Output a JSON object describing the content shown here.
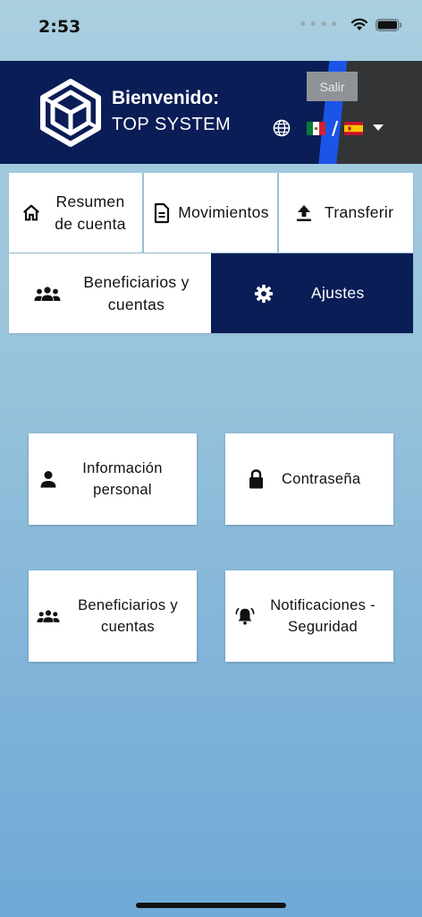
{
  "status": {
    "time": "2:53"
  },
  "header": {
    "welcome": "Bienvenido:",
    "company": "TOP SYSTEM",
    "logout_label": "Salir",
    "lang_separator": "/"
  },
  "nav": {
    "items": [
      {
        "label": "Resumen de cuenta",
        "icon": "home-icon"
      },
      {
        "label": "Movimientos",
        "icon": "document-icon"
      },
      {
        "label": "Transferir",
        "icon": "upload-icon"
      },
      {
        "label": "Beneficiarios y cuentas",
        "icon": "people-icon"
      },
      {
        "label": "Ajustes",
        "icon": "gear-icon",
        "active": true
      }
    ]
  },
  "settings": {
    "cards": [
      {
        "label": "Información personal",
        "icon": "person-icon"
      },
      {
        "label": "Contraseña",
        "icon": "lock-icon"
      },
      {
        "label": "Beneficiarios y cuentas",
        "icon": "people-icon"
      },
      {
        "label": "Notificaciones - Seguridad",
        "icon": "bell-alert-icon"
      }
    ]
  },
  "colors": {
    "header_bg": "#0b1d56",
    "accent_stripe": "#1a55e8",
    "active_tab_bg": "#0b1d56",
    "logout_bg": "#8f9296"
  }
}
